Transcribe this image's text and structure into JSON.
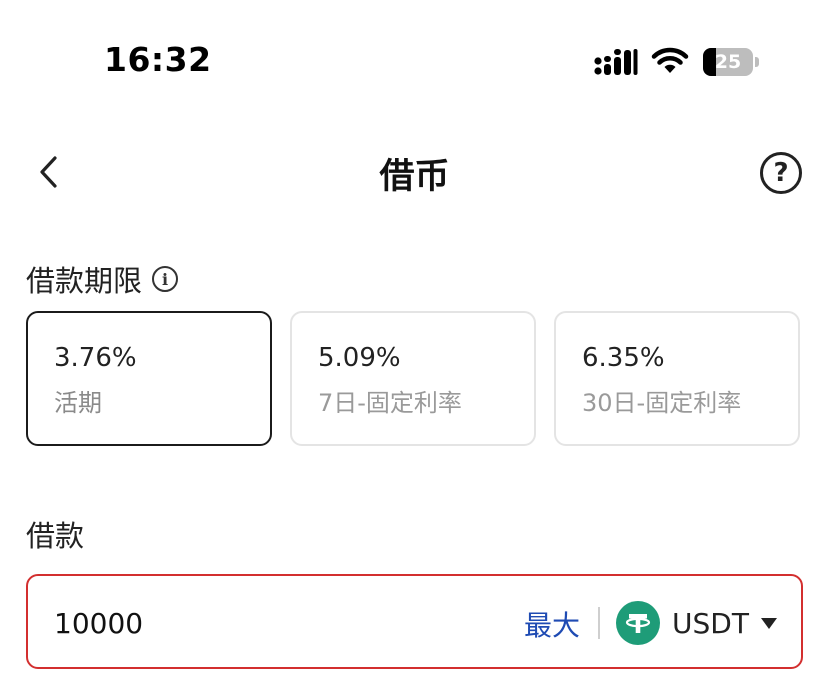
{
  "status_bar": {
    "time": "16:32",
    "battery_level": "25"
  },
  "header": {
    "title": "借币",
    "help_label": "?"
  },
  "term_section": {
    "label": "借款期限",
    "options": [
      {
        "rate": "3.76%",
        "desc": "活期",
        "selected": true
      },
      {
        "rate": "5.09%",
        "desc": "7日-固定利率",
        "selected": false
      },
      {
        "rate": "6.35%",
        "desc": "30日-固定利率",
        "selected": false
      }
    ]
  },
  "borrow_section": {
    "label": "借款",
    "amount_value": "10000",
    "max_label": "最大",
    "currency": "USDT"
  },
  "colors": {
    "selected_border": "#1b1b1b",
    "error_border": "#d32f2f",
    "link_blue": "#1f4bb3",
    "tether_green": "#1e9c78"
  },
  "icons": {
    "back": "chevron-left-icon",
    "help": "question-circle-icon",
    "info": "info-icon",
    "currency": "tether-icon",
    "dropdown": "chevron-down-icon"
  }
}
